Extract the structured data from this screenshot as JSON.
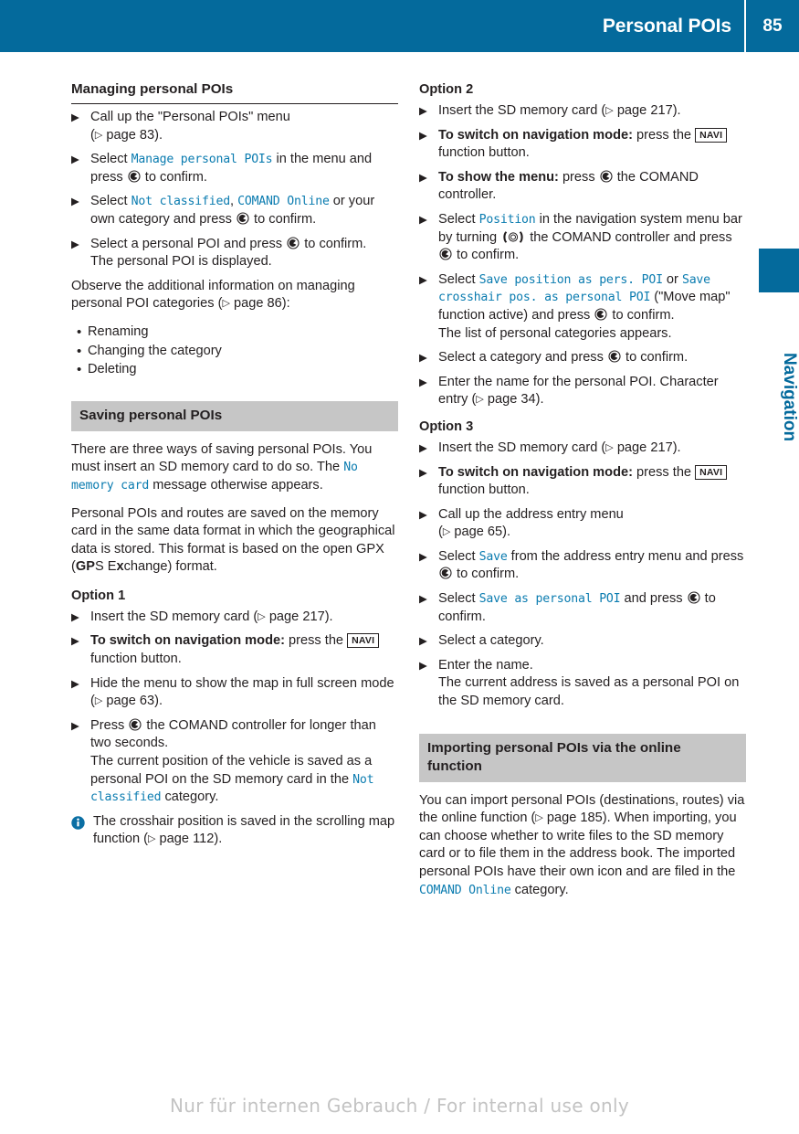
{
  "header": {
    "title": "Personal POIs",
    "page_number": "85"
  },
  "side_tab": {
    "label": "Navigation"
  },
  "watermark": "Nur für internen Gebrauch / For internal use only",
  "colors": {
    "brand_blue": "#046a9c",
    "mono_blue": "#0b7cb0",
    "gray_heading": "#c6c6c6",
    "text": "#231f20"
  },
  "icons": {
    "press_controller": "press-comand-controller-icon",
    "turn_controller": "turn-comand-controller-icon",
    "info": "info-icon",
    "reference": "reference-arrow-icon",
    "navi_button": "navi-function-button"
  },
  "left_column": {
    "section_title": "Managing personal POIs",
    "steps": [
      {
        "parts": [
          {
            "t": "text",
            "v": "Call up the \"Personal POIs\" menu"
          },
          {
            "t": "break"
          },
          {
            "t": "text",
            "v": "("
          },
          {
            "t": "ref"
          },
          {
            "t": "text",
            "v": " page 83)."
          }
        ]
      },
      {
        "parts": [
          {
            "t": "text",
            "v": "Select "
          },
          {
            "t": "mono",
            "v": "Manage personal POIs"
          },
          {
            "t": "text",
            "v": " in the menu and press "
          },
          {
            "t": "press"
          },
          {
            "t": "text",
            "v": " to confirm."
          }
        ]
      },
      {
        "parts": [
          {
            "t": "text",
            "v": "Select "
          },
          {
            "t": "mono",
            "v": "Not classified"
          },
          {
            "t": "text",
            "v": ", "
          },
          {
            "t": "mono",
            "v": "COMAND Online"
          },
          {
            "t": "text",
            "v": " or your own category and press "
          },
          {
            "t": "press"
          },
          {
            "t": "text",
            "v": " to confirm."
          }
        ]
      },
      {
        "parts": [
          {
            "t": "text",
            "v": "Select a personal POI and press "
          },
          {
            "t": "press"
          },
          {
            "t": "text",
            "v": " to confirm."
          },
          {
            "t": "sub",
            "v": "The personal POI is displayed."
          }
        ]
      }
    ],
    "observe_paragraph": {
      "parts": [
        {
          "t": "text",
          "v": "Observe the additional information on managing personal POI categories ("
        },
        {
          "t": "ref"
        },
        {
          "t": "text",
          "v": " page 86):"
        }
      ]
    },
    "observe_bullets": [
      "Renaming",
      "Changing the category",
      "Deleting"
    ],
    "saving_heading": "Saving personal POIs",
    "saving_p1": {
      "parts": [
        {
          "t": "text",
          "v": "There are three ways of saving personal POIs. You must insert an SD memory card to do so. The "
        },
        {
          "t": "mono",
          "v": "No memory card"
        },
        {
          "t": "text",
          "v": " message otherwise appears."
        }
      ]
    },
    "saving_p2": {
      "parts": [
        {
          "t": "text",
          "v": "Personal POIs and routes are saved on the memory card in the same data format in which the geographical data is stored. This format is based on the open GPX ("
        },
        {
          "t": "bold",
          "v": "GP"
        },
        {
          "t": "text",
          "v": "S E"
        },
        {
          "t": "bold",
          "v": "x"
        },
        {
          "t": "text",
          "v": "change) format."
        }
      ]
    },
    "option1_title": "Option 1",
    "option1_steps": [
      {
        "parts": [
          {
            "t": "text",
            "v": "Insert the SD memory card ("
          },
          {
            "t": "ref"
          },
          {
            "t": "text",
            "v": " page 217)."
          }
        ]
      },
      {
        "parts": [
          {
            "t": "bold",
            "v": "To switch on navigation mode:"
          },
          {
            "t": "text",
            "v": " press the "
          },
          {
            "t": "navi"
          },
          {
            "t": "text",
            "v": " function button."
          }
        ]
      },
      {
        "parts": [
          {
            "t": "text",
            "v": "Hide the menu to show the map in full screen mode ("
          },
          {
            "t": "ref"
          },
          {
            "t": "text",
            "v": " page 63)."
          }
        ]
      },
      {
        "parts": [
          {
            "t": "text",
            "v": "Press "
          },
          {
            "t": "press"
          },
          {
            "t": "text",
            "v": " the COMAND controller for longer than two seconds."
          },
          {
            "t": "sub_parts",
            "v": [
              {
                "t": "text",
                "v": "The current position of the vehicle is saved as a personal POI on the SD memory card in the "
              },
              {
                "t": "mono",
                "v": "Not classified"
              },
              {
                "t": "text",
                "v": " category."
              }
            ]
          }
        ]
      }
    ],
    "note": {
      "parts": [
        {
          "t": "text",
          "v": "The crosshair position is saved in the scrolling map function ("
        },
        {
          "t": "ref"
        },
        {
          "t": "text",
          "v": " page 112)."
        }
      ]
    }
  },
  "right_column": {
    "option2_title": "Option 2",
    "option2_steps": [
      {
        "parts": [
          {
            "t": "text",
            "v": "Insert the SD memory card ("
          },
          {
            "t": "ref"
          },
          {
            "t": "text",
            "v": " page 217)."
          }
        ]
      },
      {
        "parts": [
          {
            "t": "bold",
            "v": "To switch on navigation mode:"
          },
          {
            "t": "text",
            "v": " press the "
          },
          {
            "t": "navi"
          },
          {
            "t": "text",
            "v": " function button."
          }
        ]
      },
      {
        "parts": [
          {
            "t": "bold",
            "v": "To show the menu:"
          },
          {
            "t": "text",
            "v": " press "
          },
          {
            "t": "press"
          },
          {
            "t": "text",
            "v": " the COMAND controller."
          }
        ]
      },
      {
        "parts": [
          {
            "t": "text",
            "v": "Select "
          },
          {
            "t": "mono",
            "v": "Position"
          },
          {
            "t": "text",
            "v": " in the navigation system menu bar by turning "
          },
          {
            "t": "turn"
          },
          {
            "t": "text",
            "v": " the COMAND controller and press "
          },
          {
            "t": "press"
          },
          {
            "t": "text",
            "v": " to confirm."
          }
        ]
      },
      {
        "parts": [
          {
            "t": "text",
            "v": "Select "
          },
          {
            "t": "mono",
            "v": "Save position as pers. POI"
          },
          {
            "t": "text",
            "v": " or "
          },
          {
            "t": "mono",
            "v": "Save crosshair pos. as personal POI"
          },
          {
            "t": "text",
            "v": " (\"Move map\" function active) and press "
          },
          {
            "t": "press"
          },
          {
            "t": "text",
            "v": " to confirm."
          },
          {
            "t": "sub",
            "v": "The list of personal categories appears."
          }
        ]
      },
      {
        "parts": [
          {
            "t": "text",
            "v": "Select a category and press "
          },
          {
            "t": "press"
          },
          {
            "t": "text",
            "v": " to confirm."
          }
        ]
      },
      {
        "parts": [
          {
            "t": "text",
            "v": "Enter the name for the personal POI. Character entry ("
          },
          {
            "t": "ref"
          },
          {
            "t": "text",
            "v": " page 34)."
          }
        ]
      }
    ],
    "option3_title": "Option 3",
    "option3_steps": [
      {
        "parts": [
          {
            "t": "text",
            "v": "Insert the SD memory card ("
          },
          {
            "t": "ref"
          },
          {
            "t": "text",
            "v": " page 217)."
          }
        ]
      },
      {
        "parts": [
          {
            "t": "bold",
            "v": "To switch on navigation mode:"
          },
          {
            "t": "text",
            "v": " press the "
          },
          {
            "t": "navi"
          },
          {
            "t": "text",
            "v": " function button."
          }
        ]
      },
      {
        "parts": [
          {
            "t": "text",
            "v": "Call up the address entry menu"
          },
          {
            "t": "break"
          },
          {
            "t": "text",
            "v": "("
          },
          {
            "t": "ref"
          },
          {
            "t": "text",
            "v": " page 65)."
          }
        ]
      },
      {
        "parts": [
          {
            "t": "text",
            "v": "Select "
          },
          {
            "t": "mono",
            "v": "Save"
          },
          {
            "t": "text",
            "v": " from the address entry menu and press "
          },
          {
            "t": "press"
          },
          {
            "t": "text",
            "v": " to confirm."
          }
        ]
      },
      {
        "parts": [
          {
            "t": "text",
            "v": "Select "
          },
          {
            "t": "mono",
            "v": "Save as personal POI"
          },
          {
            "t": "text",
            "v": " and press "
          },
          {
            "t": "press"
          },
          {
            "t": "text",
            "v": " to confirm."
          }
        ]
      },
      {
        "parts": [
          {
            "t": "text",
            "v": "Select a category."
          }
        ]
      },
      {
        "parts": [
          {
            "t": "text",
            "v": "Enter the name."
          },
          {
            "t": "sub",
            "v": "The current address is saved as a personal POI on the SD memory card."
          }
        ]
      }
    ],
    "importing_heading": "Importing personal POIs via the online function",
    "importing_paragraph": {
      "parts": [
        {
          "t": "text",
          "v": "You can import personal POIs (destinations, routes) via the online function ("
        },
        {
          "t": "ref"
        },
        {
          "t": "text",
          "v": " page 185). When importing, you can choose whether to write files to the SD memory card or to file them in the address book. The imported personal POIs have their own icon and are filed in the "
        },
        {
          "t": "mono",
          "v": "COMAND Online"
        },
        {
          "t": "text",
          "v": " category."
        }
      ]
    }
  }
}
